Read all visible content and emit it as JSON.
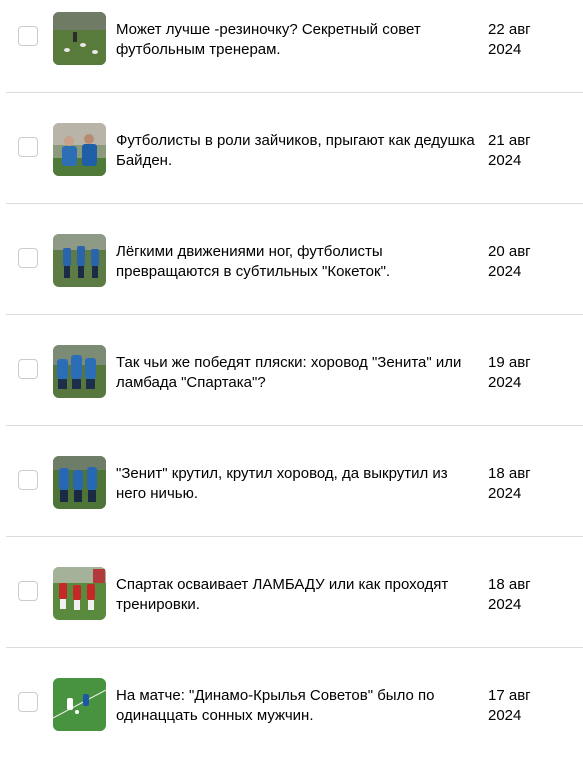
{
  "items": [
    {
      "title": "Может лучше -резиночку? Секретный совет футбольным тренерам.",
      "date_day": "22 авг",
      "date_year": "2024"
    },
    {
      "title": "Футболисты в роли зайчиков, прыгают как дедушка Байден.",
      "date_day": "21 авг",
      "date_year": "2024"
    },
    {
      "title": "Лёгкими движениями ног, футболисты превращаются в субтильных \"Кокеток\".",
      "date_day": "20 авг",
      "date_year": "2024"
    },
    {
      "title": "Так чьи же победят пляски: хоровод \"Зенита\" или ламбада \"Спартака\"?",
      "date_day": "19 авг",
      "date_year": "2024"
    },
    {
      "title": "\"Зенит\" крутил, крутил хоровод, да выкрутил из него ничью.",
      "date_day": "18 авг",
      "date_year": "2024"
    },
    {
      "title": "Спартак осваивает ЛАМБАДУ или как проходят тренировки.",
      "date_day": "18 авг",
      "date_year": "2024"
    },
    {
      "title": "На матче: \"Динамо-Крылья Советов\" было по одинаццать сонных мужчин.",
      "date_day": "17 авг",
      "date_year": "2024"
    }
  ]
}
